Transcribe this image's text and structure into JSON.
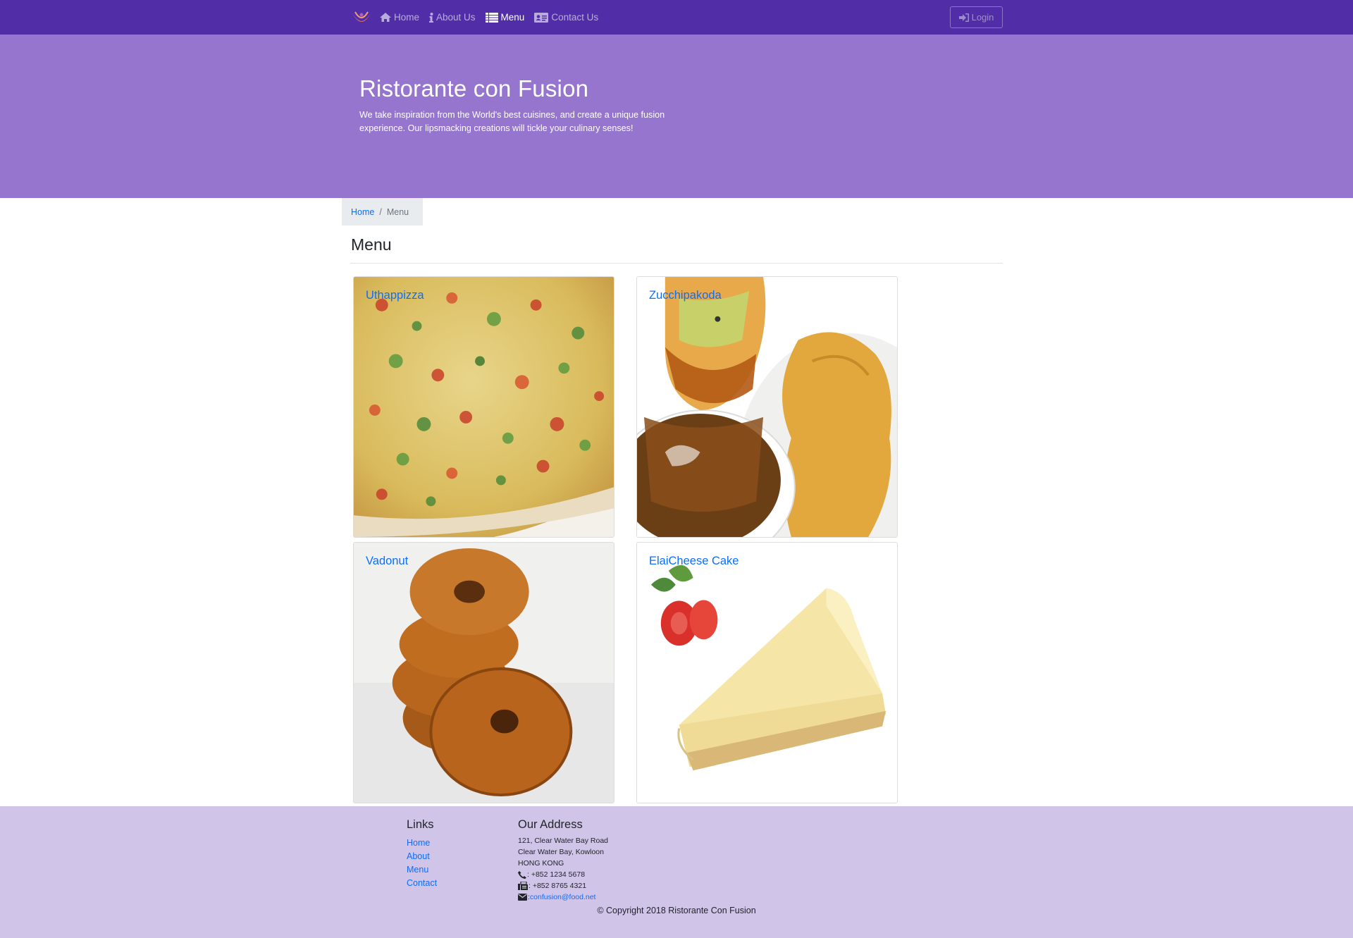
{
  "nav": {
    "brand_icon": "logo-icon",
    "items": [
      {
        "label": "Home",
        "icon": "home-icon"
      },
      {
        "label": "About Us",
        "icon": "info-icon"
      },
      {
        "label": "Menu",
        "icon": "list-icon"
      },
      {
        "label": "Contact Us",
        "icon": "address-card-icon"
      }
    ],
    "login_label": "Login",
    "colors": {
      "primary": "#512da8",
      "light": "#9575cd",
      "lighter": "#d1c4e9"
    }
  },
  "jumbotron": {
    "title": "Ristorante con Fusion",
    "text": "We take inspiration from the World's best cuisines, and create a unique fusion experience. Our lipsmacking creations will tickle your culinary senses!"
  },
  "breadcrumb": {
    "home": "Home",
    "separator": "/",
    "current": "Menu"
  },
  "page": {
    "title": "Menu"
  },
  "dishes": [
    {
      "name": "Uthappizza"
    },
    {
      "name": "Zucchipakoda"
    },
    {
      "name": "Vadonut"
    },
    {
      "name": "ElaiCheese Cake"
    }
  ],
  "footer": {
    "links_heading": "Links",
    "links": [
      "Home",
      "About",
      "Menu",
      "Contact"
    ],
    "address_heading": "Our Address",
    "address_lines": [
      "121, Clear Water Bay Road",
      "Clear Water Bay, Kowloon",
      "HONG KONG"
    ],
    "phone": ": +852 1234 5678",
    "fax": ": +852 8765 4321",
    "email_prefix": ":",
    "email": "confusion@food.net",
    "copyright": "© Copyright 2018 Ristorante Con Fusion"
  }
}
